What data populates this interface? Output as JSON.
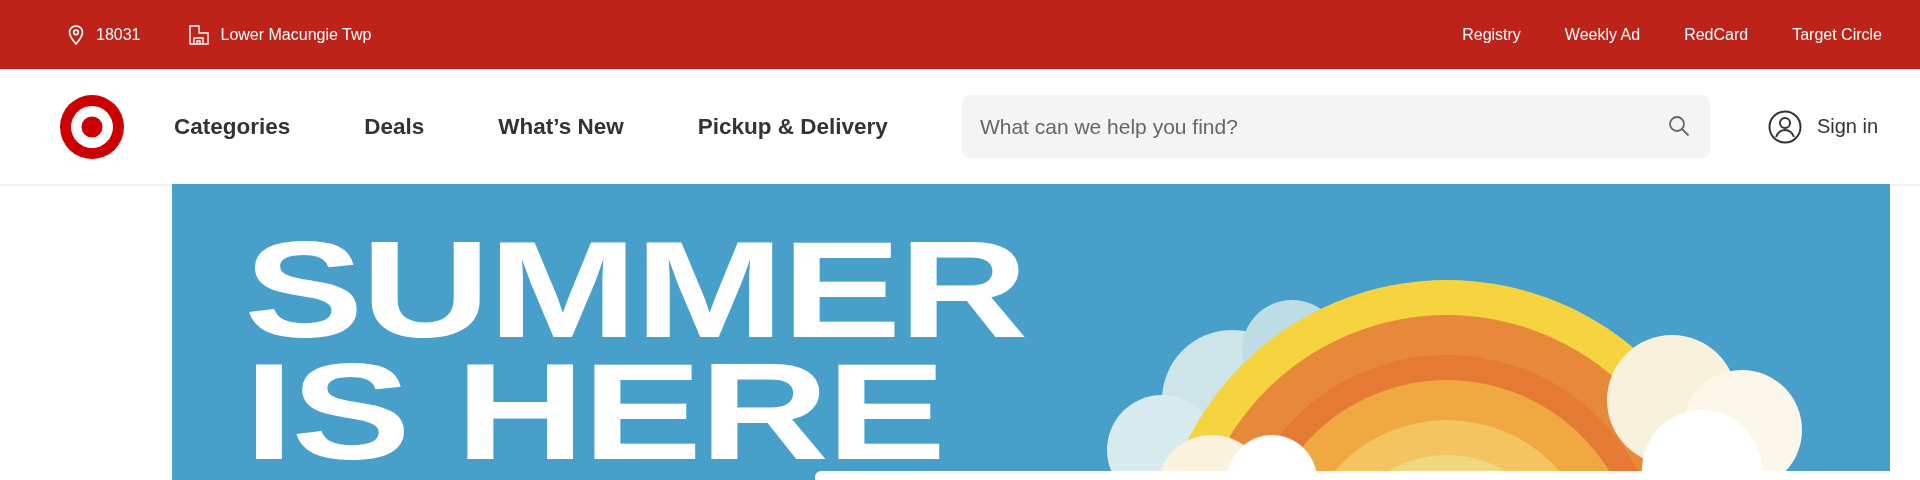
{
  "top_bar": {
    "zip": "18031",
    "store": "Lower Macungie Twp",
    "links": [
      "Registry",
      "Weekly Ad",
      "RedCard",
      "Target Circle"
    ]
  },
  "nav": {
    "links": [
      "Categories",
      "Deals",
      "What’s New",
      "Pickup & Delivery"
    ]
  },
  "search": {
    "placeholder": "What can we help you find?"
  },
  "account": {
    "label": "Sign in"
  },
  "banner": {
    "headline": [
      "SUMMER",
      "IS HERE"
    ]
  }
}
